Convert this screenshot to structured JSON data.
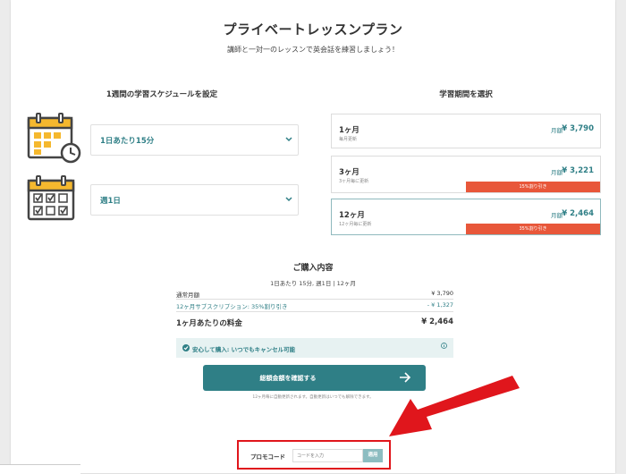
{
  "title": "プライベートレッスンプラン",
  "subtitle": "講師と一対一のレッスンで英会話を練習しましょう！",
  "schedule": {
    "heading": "1週間の学習スケジュールを設定",
    "minutes_select": "1日あたり15分",
    "days_select": "週1日"
  },
  "period": {
    "heading": "学習期間を選択",
    "plans": [
      {
        "name": "1ヶ月",
        "note": "毎月更新",
        "price_label": "月額",
        "price": "¥ 3,790",
        "badge": ""
      },
      {
        "name": "3ヶ月",
        "note": "3ヶ月毎に更新",
        "price_label": "月額",
        "price": "¥ 3,221",
        "badge": "15%割り引き"
      },
      {
        "name": "12ヶ月",
        "note": "12ヶ月毎に更新",
        "price_label": "月額",
        "price": "¥ 2,464",
        "badge": "35%割り引き"
      }
    ]
  },
  "summary": {
    "title": "ご購入内容",
    "subtitle": "1日あたり 15分, 週1日 | 12ヶ月",
    "rows": [
      {
        "label": "通常月額",
        "value": "¥ 3,790"
      },
      {
        "label": "12ヶ月サブスクリプション: 35%割り引き",
        "value": "- ¥ 1,327"
      }
    ],
    "total_label": "1ヶ月あたりの料金",
    "total_value": "¥ 2,464"
  },
  "notice": "安心して購入: いつでもキャンセル可能",
  "cta": {
    "label": "総額金額を確認する",
    "note": "12ヶ月毎に自動更新されます。自動更新はいつでも解除できます。"
  },
  "promo": {
    "label": "プロモコード",
    "placeholder": "コードを入力",
    "apply": "適用"
  },
  "colors": {
    "teal": "#2f7f86",
    "discount_badge": "#e8573a",
    "highlight_red": "#e0161c",
    "calendar_yellow": "#f5b82e"
  }
}
